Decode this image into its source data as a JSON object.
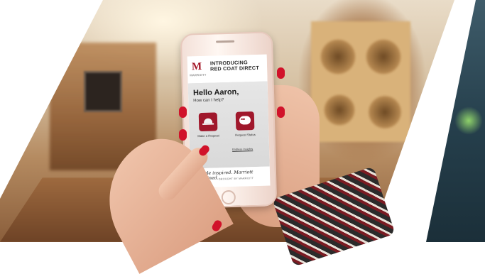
{
  "app": {
    "brand": "MARRIOTT",
    "title_line1": "INTRODUCING",
    "title_line2": "RED COAT DIRECT",
    "greeting": "Hello Aaron,",
    "prompt": "How can I help?",
    "actions": [
      {
        "label": "Make a Request",
        "icon": "service-bell-icon"
      },
      {
        "label": "Request Status",
        "icon": "chat-bubble-icon"
      }
    ],
    "link": "Endless Insights",
    "tagline": "People inspired. Marriott imagined.",
    "footer_note": "BROUGHT BY MARRIOTT"
  },
  "colors": {
    "brand_red": "#a0182c",
    "nail_red": "#d1122a"
  }
}
